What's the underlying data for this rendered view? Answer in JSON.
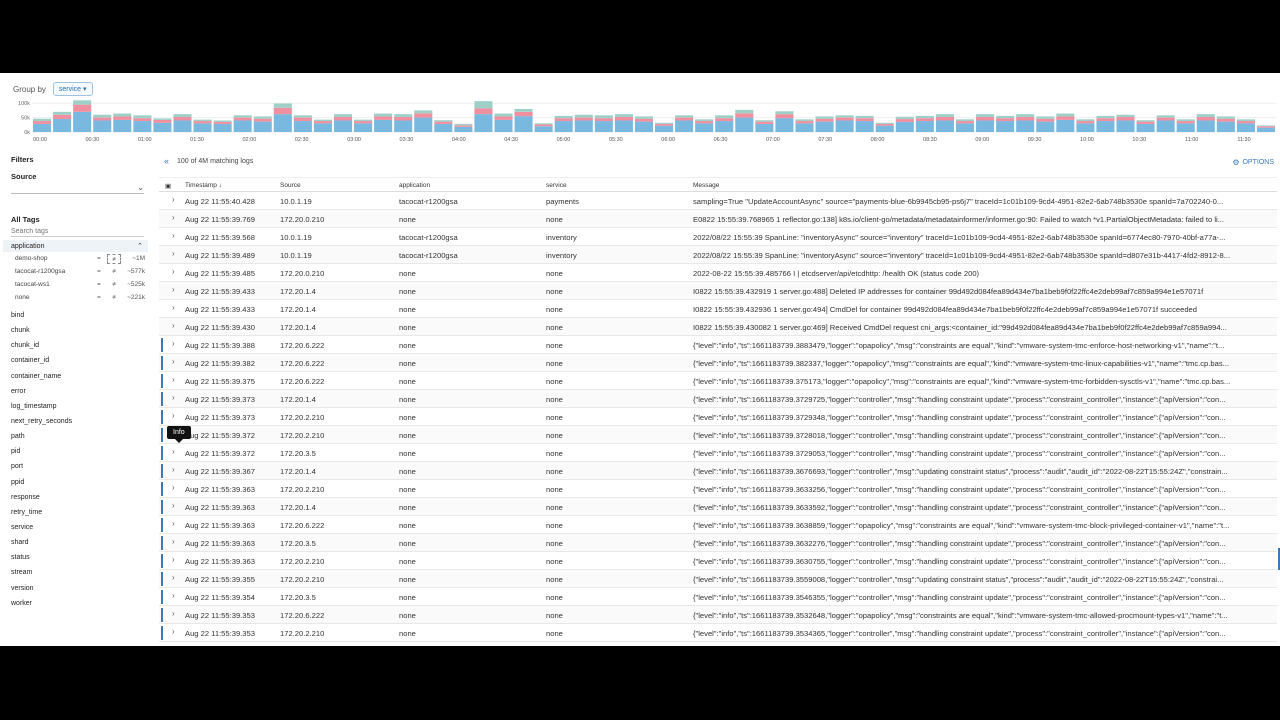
{
  "group_by": {
    "label": "Group by",
    "value": "service"
  },
  "histogram": {
    "y_ticks": [
      "100k",
      "50k",
      "0k"
    ],
    "x_ticks": [
      "00:00",
      "00:30",
      "01:00",
      "01:30",
      "02:00",
      "02:30",
      "03:00",
      "03:30",
      "04:00",
      "04:30",
      "05:00",
      "05:30",
      "06:00",
      "06:30",
      "07:00",
      "07:30",
      "08:00",
      "08:30",
      "09:00",
      "09:30",
      "10:00",
      "10:30",
      "11:00",
      "11:30"
    ],
    "colors": {
      "base": "#79b9df",
      "mid": "#f08fa0",
      "top": "#9fd0c8"
    },
    "bars": [
      [
        28,
        10,
        8
      ],
      [
        45,
        15,
        10
      ],
      [
        70,
        25,
        15
      ],
      [
        40,
        10,
        10
      ],
      [
        42,
        12,
        10
      ],
      [
        38,
        10,
        10
      ],
      [
        32,
        10,
        5
      ],
      [
        40,
        12,
        10
      ],
      [
        30,
        8,
        5
      ],
      [
        28,
        7,
        5
      ],
      [
        40,
        10,
        8
      ],
      [
        36,
        10,
        8
      ],
      [
        62,
        22,
        15
      ],
      [
        38,
        12,
        8
      ],
      [
        30,
        8,
        5
      ],
      [
        40,
        12,
        10
      ],
      [
        30,
        8,
        5
      ],
      [
        42,
        12,
        10
      ],
      [
        40,
        12,
        10
      ],
      [
        50,
        15,
        10
      ],
      [
        28,
        8,
        5
      ],
      [
        18,
        5,
        5
      ],
      [
        62,
        20,
        25
      ],
      [
        42,
        12,
        10
      ],
      [
        55,
        15,
        10
      ],
      [
        20,
        6,
        4
      ],
      [
        38,
        10,
        8
      ],
      [
        40,
        10,
        10
      ],
      [
        38,
        10,
        10
      ],
      [
        40,
        12,
        10
      ],
      [
        36,
        10,
        8
      ],
      [
        22,
        6,
        4
      ],
      [
        40,
        10,
        8
      ],
      [
        30,
        8,
        6
      ],
      [
        38,
        10,
        10
      ],
      [
        50,
        15,
        12
      ],
      [
        28,
        8,
        5
      ],
      [
        48,
        14,
        10
      ],
      [
        30,
        8,
        6
      ],
      [
        36,
        10,
        8
      ],
      [
        40,
        10,
        8
      ],
      [
        38,
        10,
        8
      ],
      [
        22,
        6,
        4
      ],
      [
        35,
        10,
        8
      ],
      [
        38,
        10,
        8
      ],
      [
        40,
        12,
        10
      ],
      [
        30,
        8,
        6
      ],
      [
        40,
        12,
        10
      ],
      [
        38,
        10,
        8
      ],
      [
        40,
        12,
        10
      ],
      [
        36,
        10,
        8
      ],
      [
        42,
        12,
        10
      ],
      [
        30,
        8,
        6
      ],
      [
        38,
        10,
        8
      ],
      [
        40,
        12,
        8
      ],
      [
        28,
        8,
        5
      ],
      [
        40,
        10,
        8
      ],
      [
        30,
        8,
        6
      ],
      [
        40,
        12,
        10
      ],
      [
        36,
        10,
        8
      ],
      [
        30,
        8,
        6
      ],
      [
        15,
        5,
        3
      ]
    ]
  },
  "sidebar": {
    "filters_label": "Filters",
    "source_label": "Source",
    "all_tags_label": "All Tags",
    "search_placeholder": "Search tags",
    "application": {
      "label": "application",
      "items": [
        {
          "name": "demo-shop",
          "eq": "=",
          "ne": "≠",
          "count": "~1M"
        },
        {
          "name": "tacocat-r1200gsa",
          "eq": "=",
          "ne": "≠",
          "count": "~577k"
        },
        {
          "name": "tacocat-ws1",
          "eq": "=",
          "ne": "≠",
          "count": "~525k"
        },
        {
          "name": "none",
          "eq": "=",
          "ne": "≠",
          "count": "~221k"
        }
      ]
    },
    "tags": [
      "bind",
      "chunk",
      "chunk_id",
      "container_id",
      "container_name",
      "error",
      "log_timestamp",
      "next_retry_seconds",
      "path",
      "pid",
      "port",
      "ppid",
      "response",
      "retry_time",
      "service",
      "shard",
      "status",
      "stream",
      "version",
      "worker"
    ]
  },
  "main": {
    "match_count": "100 of 4M matching logs",
    "options_label": "OPTIONS",
    "columns": {
      "timestamp": "Timestamp",
      "source": "Source",
      "application": "application",
      "service": "service",
      "message": "Message"
    },
    "tooltip": "Info",
    "rows": [
      {
        "ts": "Aug 22 11:55:40.428",
        "src": "10.0.1.19",
        "app": "tacocat-r1200gsa",
        "svc": "payments",
        "msg": "sampling=True \"UpdateAccountAsync\" source=\"payments-blue-6b9945cb95-ps6j7\" traceId=1c01b109-9cd4-4951-82e2-6ab748b3530e spanId=7a702240-0...",
        "accent": false
      },
      {
        "ts": "Aug 22 11:55:39.769",
        "src": "172.20.0.210",
        "app": "none",
        "svc": "none",
        "msg": "E0822 15:55:39.768965 1 reflector.go:138] k8s.io/client-go/metadata/metadatainformer/informer.go:90: Failed to watch *v1.PartialObjectMetadata: failed to li...",
        "accent": false
      },
      {
        "ts": "Aug 22 11:55:39.568",
        "src": "10.0.1.19",
        "app": "tacocat-r1200gsa",
        "svc": "inventory",
        "msg": "2022/08/22 15:55:39 SpanLine: \"inventoryAsync\" source=\"inventory\" traceId=1c01b109-9cd4-4951-82e2-6ab748b3530e spanId=6774ec80-7970-40bf-a77a-...",
        "accent": false
      },
      {
        "ts": "Aug 22 11:55:39.489",
        "src": "10.0.1.19",
        "app": "tacocat-r1200gsa",
        "svc": "inventory",
        "msg": "2022/08/22 15:55:39 SpanLine: \"inventoryAsync\" source=\"inventory\" traceId=1c01b109-9cd4-4951-82e2-6ab748b3530e spanId=d807e31b-4417-4fd2-8912-8...",
        "accent": false
      },
      {
        "ts": "Aug 22 11:55:39.485",
        "src": "172.20.0.210",
        "app": "none",
        "svc": "none",
        "msg": "2022-08-22 15:55:39.485766 I | etcdserver/api/etcdhttp: /health OK (status code 200)",
        "accent": false
      },
      {
        "ts": "Aug 22 11:55:39.433",
        "src": "172.20.1.4",
        "app": "none",
        "svc": "none",
        "msg": "I0822 15:55:39.432919 1 server.go:488] Deleted IP addresses for container 99d492d084fea89d434e7ba1beb9f0f22ffc4e2deb99af7c859a994e1e57071f",
        "accent": false
      },
      {
        "ts": "Aug 22 11:55:39.433",
        "src": "172.20.1.4",
        "app": "none",
        "svc": "none",
        "msg": "I0822 15:55:39.432936 1 server.go:494] CmdDel for container 99d492d084fea89d434e7ba1beb9f0f22ffc4e2deb99af7c859a994e1e57071f succeeded",
        "accent": false
      },
      {
        "ts": "Aug 22 11:55:39.430",
        "src": "172.20.1.4",
        "app": "none",
        "svc": "none",
        "msg": "I0822 15:55:39.430082 1 server.go:469] Received CmdDel request cni_args:<container_id:\"99d492d084fea89d434e7ba1beb9f0f22ffc4e2deb99af7c859a994...",
        "accent": false
      },
      {
        "ts": "Aug 22 11:55:39.388",
        "src": "172.20.6.222",
        "app": "none",
        "svc": "none",
        "msg": "{\"level\":\"info\",\"ts\":1661183739.3883479,\"logger\":\"opapolicy\",\"msg\":\"constraints are equal\",\"kind\":\"vmware-system-tmc-enforce-host-networking-v1\",\"name\":\"t...",
        "accent": true
      },
      {
        "ts": "Aug 22 11:55:39.382",
        "src": "172.20.6.222",
        "app": "none",
        "svc": "none",
        "msg": "{\"level\":\"info\",\"ts\":1661183739.382337,\"logger\":\"opapolicy\",\"msg\":\"constraints are equal\",\"kind\":\"vmware-system-tmc-linux-capabilities-v1\",\"name\":\"tmc.cp.bas...",
        "accent": true
      },
      {
        "ts": "Aug 22 11:55:39.375",
        "src": "172.20.6.222",
        "app": "none",
        "svc": "none",
        "msg": "{\"level\":\"info\",\"ts\":1661183739.375173,\"logger\":\"opapolicy\",\"msg\":\"constraints are equal\",\"kind\":\"vmware-system-tmc-forbidden-sysctls-v1\",\"name\":\"tmc.cp.bas...",
        "accent": true
      },
      {
        "ts": "Aug 22 11:55:39.373",
        "src": "172.20.1.4",
        "app": "none",
        "svc": "none",
        "msg": "{\"level\":\"info\",\"ts\":1661183739.3729725,\"logger\":\"controller\",\"msg\":\"handling constraint update\",\"process\":\"constraint_controller\",\"instance\":{\"apiVersion\":\"con...",
        "accent": true
      },
      {
        "ts": "Aug 22 11:55:39.373",
        "src": "172.20.2.210",
        "app": "none",
        "svc": "none",
        "msg": "{\"level\":\"info\",\"ts\":1661183739.3729348,\"logger\":\"controller\",\"msg\":\"handling constraint update\",\"process\":\"constraint_controller\",\"instance\":{\"apiVersion\":\"con...",
        "accent": true
      },
      {
        "ts": "Aug 22 11:55:39.372",
        "src": "172.20.2.210",
        "app": "none",
        "svc": "none",
        "msg": "{\"level\":\"info\",\"ts\":1661183739.3728018,\"logger\":\"controller\",\"msg\":\"handling constraint update\",\"process\":\"constraint_controller\",\"instance\":{\"apiVersion\":\"con...",
        "accent": true
      },
      {
        "ts": "Aug 22 11:55:39.372",
        "src": "172.20.3.5",
        "app": "none",
        "svc": "none",
        "msg": "{\"level\":\"info\",\"ts\":1661183739.3729053,\"logger\":\"controller\",\"msg\":\"handling constraint update\",\"process\":\"constraint_controller\",\"instance\":{\"apiVersion\":\"con...",
        "accent": true
      },
      {
        "ts": "Aug 22 11:55:39.367",
        "src": "172.20.1.4",
        "app": "none",
        "svc": "none",
        "msg": "{\"level\":\"info\",\"ts\":1661183739.3676693,\"logger\":\"controller\",\"msg\":\"updating constraint status\",\"process\":\"audit\",\"audit_id\":\"2022-08-22T15:55:24Z\",\"constrain...",
        "accent": true
      },
      {
        "ts": "Aug 22 11:55:39.363",
        "src": "172.20.2.210",
        "app": "none",
        "svc": "none",
        "msg": "{\"level\":\"info\",\"ts\":1661183739.3633256,\"logger\":\"controller\",\"msg\":\"handling constraint update\",\"process\":\"constraint_controller\",\"instance\":{\"apiVersion\":\"con...",
        "accent": true
      },
      {
        "ts": "Aug 22 11:55:39.363",
        "src": "172.20.1.4",
        "app": "none",
        "svc": "none",
        "msg": "{\"level\":\"info\",\"ts\":1661183739.3633592,\"logger\":\"controller\",\"msg\":\"handling constraint update\",\"process\":\"constraint_controller\",\"instance\":{\"apiVersion\":\"con...",
        "accent": true
      },
      {
        "ts": "Aug 22 11:55:39.363",
        "src": "172.20.6.222",
        "app": "none",
        "svc": "none",
        "msg": "{\"level\":\"info\",\"ts\":1661183739.3638859,\"logger\":\"opapolicy\",\"msg\":\"constraints are equal\",\"kind\":\"vmware-system-tmc-block-privileged-container-v1\",\"name\":\"t...",
        "accent": true
      },
      {
        "ts": "Aug 22 11:55:39.363",
        "src": "172.20.3.5",
        "app": "none",
        "svc": "none",
        "msg": "{\"level\":\"info\",\"ts\":1661183739.3632276,\"logger\":\"controller\",\"msg\":\"handling constraint update\",\"process\":\"constraint_controller\",\"instance\":{\"apiVersion\":\"con...",
        "accent": true
      },
      {
        "ts": "Aug 22 11:55:39.363",
        "src": "172.20.2.210",
        "app": "none",
        "svc": "none",
        "msg": "{\"level\":\"info\",\"ts\":1661183739.3630755,\"logger\":\"controller\",\"msg\":\"handling constraint update\",\"process\":\"constraint_controller\",\"instance\":{\"apiVersion\":\"con...",
        "accent": true
      },
      {
        "ts": "Aug 22 11:55:39.355",
        "src": "172.20.2.210",
        "app": "none",
        "svc": "none",
        "msg": "{\"level\":\"info\",\"ts\":1661183739.3559008,\"logger\":\"controller\",\"msg\":\"updating constraint status\",\"process\":\"audit\",\"audit_id\":\"2022-08-22T15:55:24Z\",\"constrai...",
        "accent": true
      },
      {
        "ts": "Aug 22 11:55:39.354",
        "src": "172.20.3.5",
        "app": "none",
        "svc": "none",
        "msg": "{\"level\":\"info\",\"ts\":1661183739.3546355,\"logger\":\"controller\",\"msg\":\"handling constraint update\",\"process\":\"constraint_controller\",\"instance\":{\"apiVersion\":\"con...",
        "accent": true
      },
      {
        "ts": "Aug 22 11:55:39.353",
        "src": "172.20.6.222",
        "app": "none",
        "svc": "none",
        "msg": "{\"level\":\"info\",\"ts\":1661183739.3532648,\"logger\":\"opapolicy\",\"msg\":\"constraints are equal\",\"kind\":\"vmware-system-tmc-allowed-procmount-types-v1\",\"name\":\"t...",
        "accent": true
      },
      {
        "ts": "Aug 22 11:55:39.353",
        "src": "172.20.2.210",
        "app": "none",
        "svc": "none",
        "msg": "{\"level\":\"info\",\"ts\":1661183739.3534365,\"logger\":\"controller\",\"msg\":\"handling constraint update\",\"process\":\"constraint_controller\",\"instance\":{\"apiVersion\":\"con...",
        "accent": true
      }
    ]
  }
}
